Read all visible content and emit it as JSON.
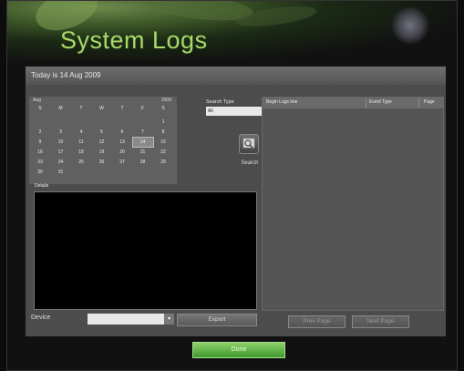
{
  "window": {
    "title": "System Logs"
  },
  "date_bar": {
    "text": "Today is 14 Aug 2009"
  },
  "calendar": {
    "month": "Aug",
    "year": "2009",
    "weekdays": [
      "S",
      "M",
      "T",
      "W",
      "T",
      "F",
      "S"
    ],
    "weeks": [
      [
        "",
        "",
        "",
        "",
        "",
        "",
        "1"
      ],
      [
        "2",
        "3",
        "4",
        "5",
        "6",
        "7",
        "8"
      ],
      [
        "9",
        "10",
        "11",
        "12",
        "13",
        "14",
        "15"
      ],
      [
        "16",
        "17",
        "18",
        "19",
        "20",
        "21",
        "22"
      ],
      [
        "23",
        "24",
        "25",
        "26",
        "27",
        "28",
        "29"
      ],
      [
        "30",
        "31",
        "",
        "",
        "",
        "",
        ""
      ]
    ],
    "selected_day": "14"
  },
  "search": {
    "type_label": "Search Type",
    "type_value": "All",
    "button_label": "Search"
  },
  "details": {
    "label": "Details"
  },
  "log_table": {
    "columns": [
      "Begin Logs ime",
      "Event Type",
      "Page"
    ]
  },
  "footer": {
    "device_label": "Device",
    "device_value": "",
    "export_label": "Export",
    "prev_label": "Prev Page",
    "next_label": "Next Page",
    "done_label": "Done"
  },
  "colors": {
    "title": "#a8d96c",
    "panel": "#4c4c4c",
    "done_button": "#5bb33f"
  }
}
